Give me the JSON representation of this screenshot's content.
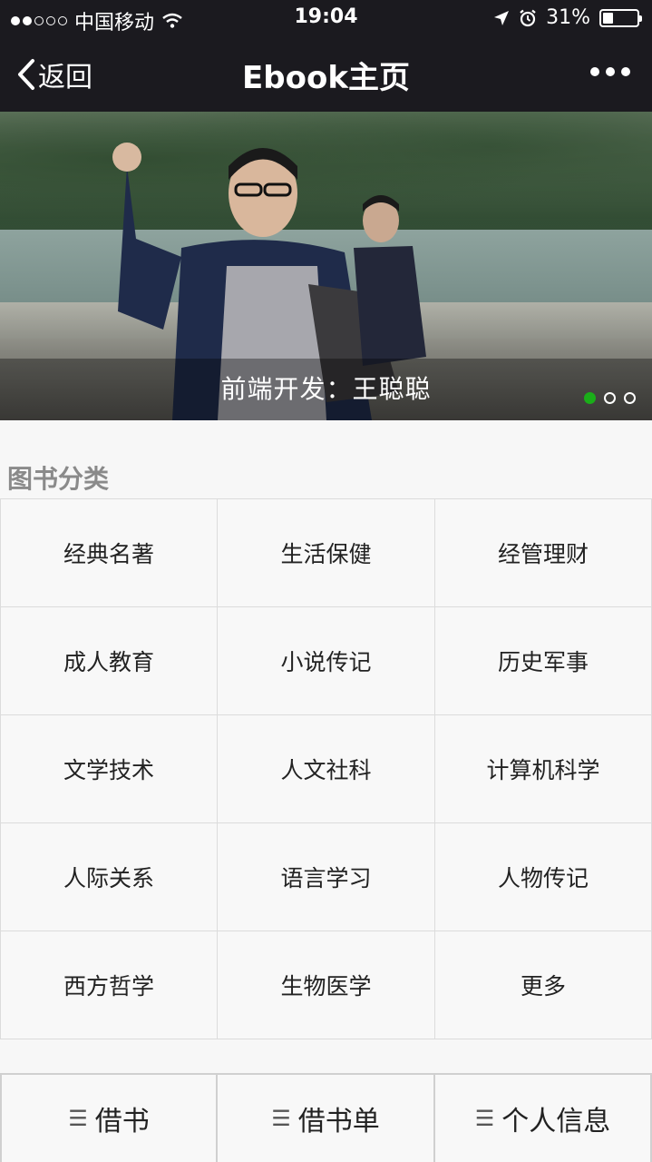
{
  "status_bar": {
    "carrier": "中国移动",
    "time": "19:04",
    "battery": "31%",
    "battery_level": 0.31,
    "signal_dots_filled": 2,
    "signal_dots_total": 5
  },
  "nav": {
    "back_label": "返回",
    "title": "Ebook主页"
  },
  "banner": {
    "caption": "前端开发：王聪聪",
    "page_count": 3,
    "active_page": 1,
    "active_color": "#1aad19"
  },
  "section": {
    "title": "图书分类"
  },
  "categories": [
    "经典名著",
    "生活保健",
    "经管理财",
    "成人教育",
    "小说传记",
    "历史军事",
    "文学技术",
    "人文社科",
    "计算机科学",
    "人际关系",
    "语言学习",
    "人物传记",
    "西方哲学",
    "生物医学",
    "更多"
  ],
  "tabs": [
    {
      "icon": "menu-icon",
      "label": "借书"
    },
    {
      "icon": "menu-icon",
      "label": "借书单"
    },
    {
      "icon": "menu-icon",
      "label": "个人信息"
    }
  ]
}
